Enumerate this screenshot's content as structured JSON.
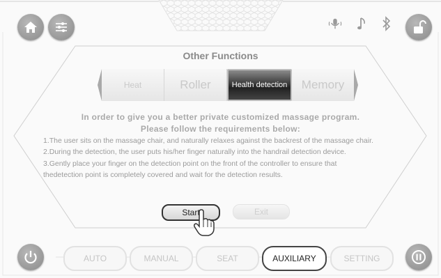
{
  "header": {
    "icons": [
      "home-icon",
      "sliders-icon",
      "voice-icon",
      "music-icon",
      "bluetooth-icon",
      "unlock-icon"
    ]
  },
  "panel": {
    "title": "Other Functions",
    "tabs": [
      {
        "label": "Heat",
        "active": false
      },
      {
        "label": "Roller",
        "active": false
      },
      {
        "label": "Health detection",
        "active": true
      },
      {
        "label": "Memory",
        "active": false
      }
    ],
    "intro_line1": "In order to give you a better private customized massage program.",
    "intro_line2": "Please follow the requirements below:",
    "requirements": [
      "1.The user sits on the massage chair, and naturally relaxes against the backrest of the massage chair.",
      "2.During the detection, the user puts his/her finger naturally into the handrail detection device.",
      "3.Gently place your finger on the detection point on the front of the controller to ensure that",
      " thedetection point is completely covered and wait for the detection results."
    ],
    "start_label": "Start",
    "exit_label": "Exit"
  },
  "bottom_nav": {
    "items": [
      {
        "label": "AUTO",
        "active": false
      },
      {
        "label": "MANUAL",
        "active": false
      },
      {
        "label": "SEAT",
        "active": false
      },
      {
        "label": "AUXILIARY",
        "active": true
      },
      {
        "label": "SETTING",
        "active": false
      }
    ],
    "icons": [
      "power-icon",
      "pause-icon"
    ]
  },
  "colors": {
    "accent": "#8a8a8a",
    "active_tab": "#222222"
  }
}
